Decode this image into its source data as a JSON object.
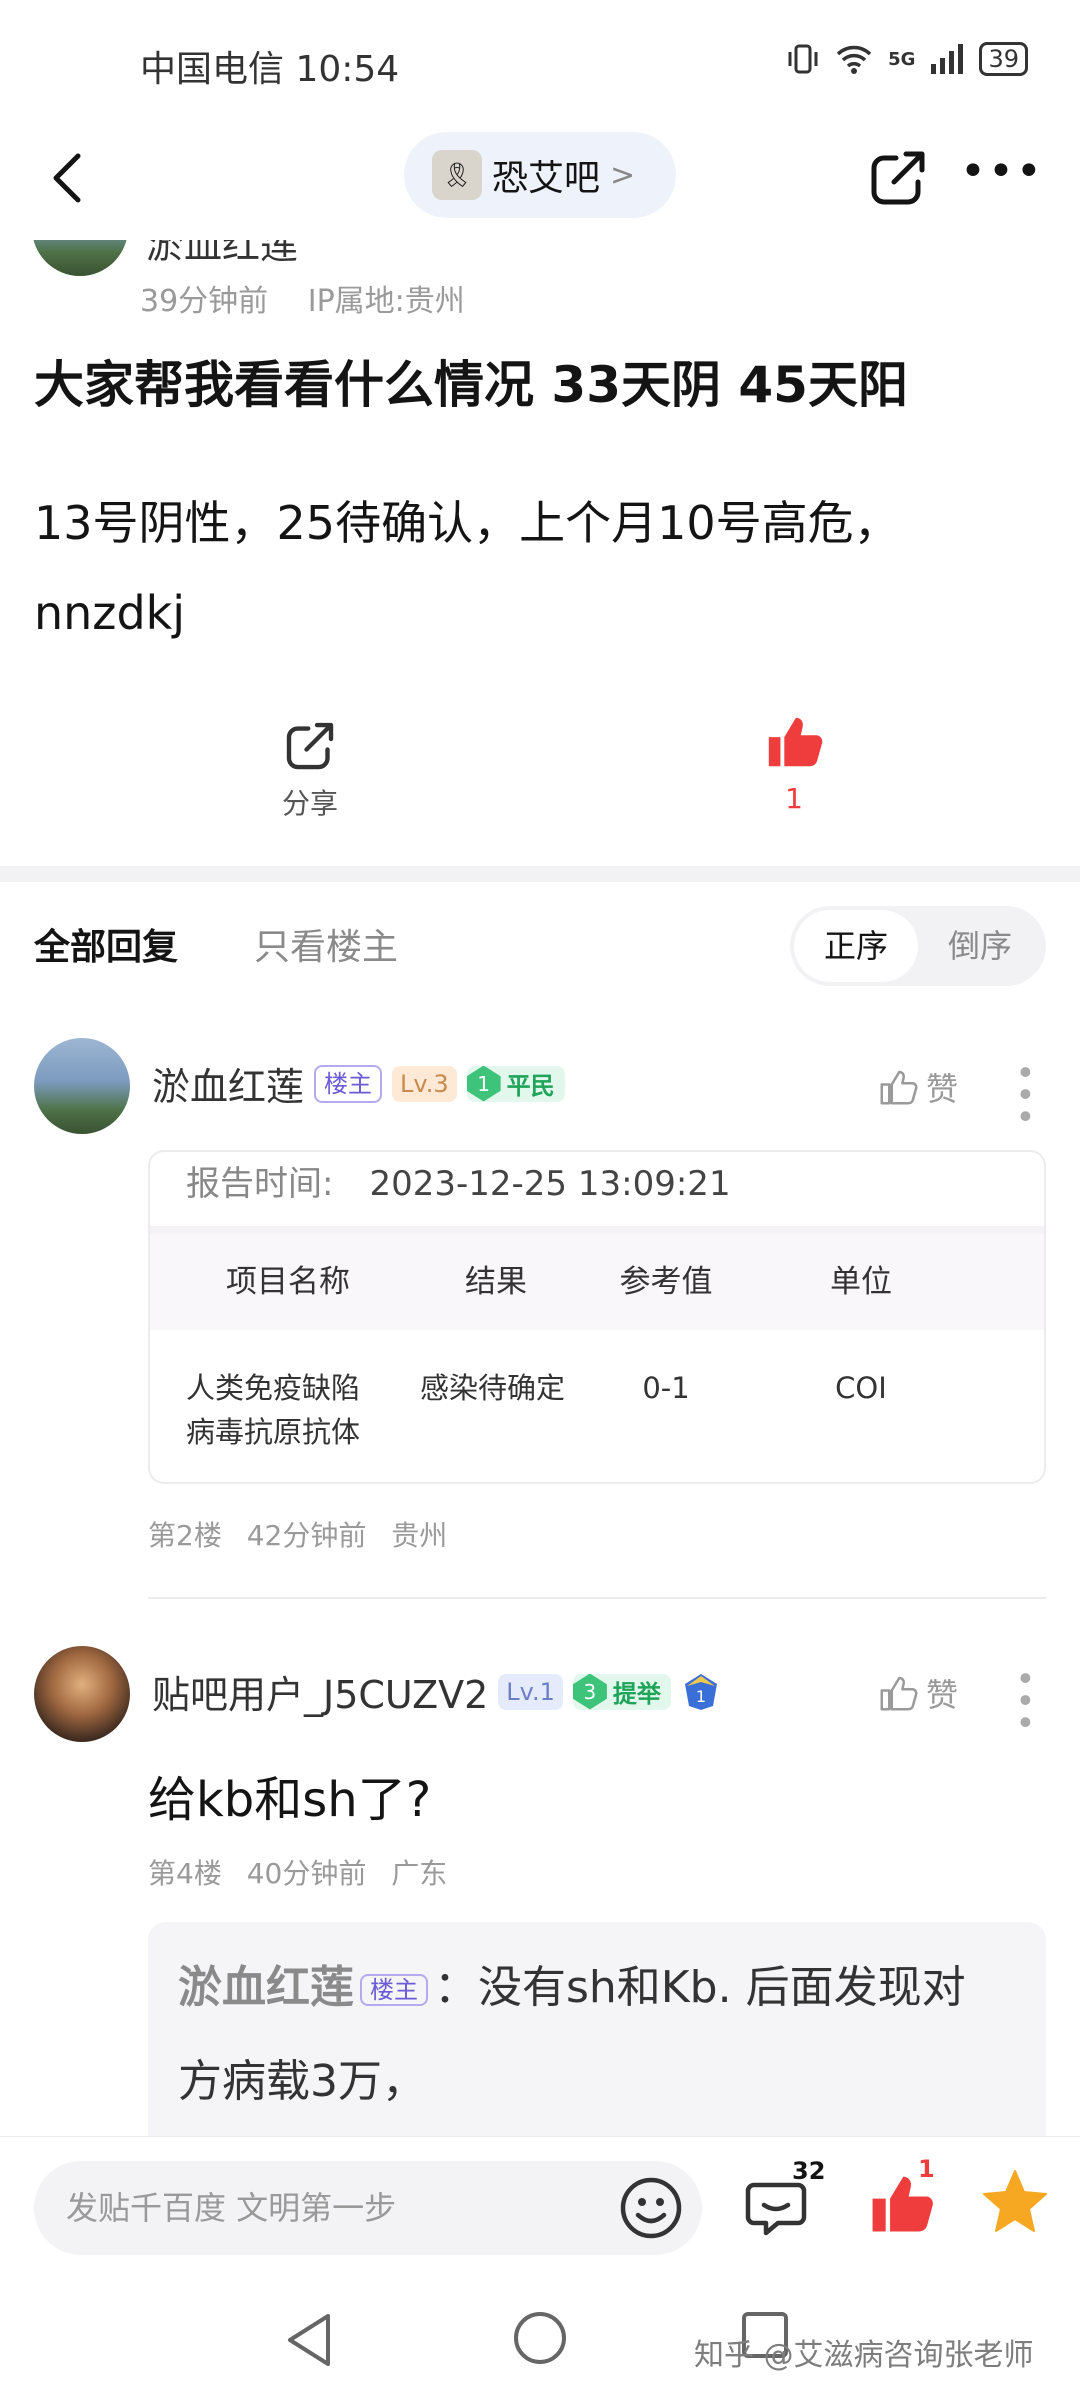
{
  "status_bar": {
    "carrier_time": "中国电信 10:54",
    "network": "5G",
    "battery": "39"
  },
  "nav": {
    "forum_name": "恐艾吧",
    "forum_chevron": ">"
  },
  "post": {
    "author_name_partial": "淤血红莲",
    "time": "39分钟前",
    "ip": "IP属地:贵州",
    "title": "大家帮我看看什么情况 33天阴 45天阳",
    "body_line1": "13号阴性，25待确认，上个月10号高危，",
    "body_line2": "nnzdkj",
    "share_label": "分享",
    "like_count": "1"
  },
  "tabs": {
    "all": "全部回复",
    "op_only": "只看楼主",
    "sort_asc": "正序",
    "sort_desc": "倒序"
  },
  "replies": [
    {
      "username": "淤血红莲",
      "op_tag": "楼主",
      "level": "Lv.3",
      "rank_num": "1",
      "rank_name": "平民",
      "like_label": "赞",
      "report": {
        "time_label": "报告时间:",
        "time_value": "2023-12-25 13:09:21",
        "headers": [
          "项目名称",
          "结果",
          "参考值",
          "单位"
        ],
        "row": {
          "item_line1": "人类免疫缺陷",
          "item_line2": "病毒抗原抗体",
          "result": "感染待确定",
          "reference": "0-1",
          "unit": "COI"
        }
      },
      "floor": "第2楼",
      "time": "42分钟前",
      "location": "贵州"
    },
    {
      "username": "贴吧用户_J5CUZV2",
      "level": "Lv.1",
      "rank_num": "3",
      "rank_name": "提举",
      "badge_num": "1",
      "like_label": "赞",
      "text": "给kb和sh了?",
      "floor": "第4楼",
      "time": "40分钟前",
      "location": "广东",
      "sub_reply": {
        "username": "淤血红莲",
        "op_tag": "楼主",
        "text_line1": "：没有sh和Kb. 后面发现对",
        "text_line2": "方病载3万，"
      }
    }
  ],
  "bottom_bar": {
    "input_placeholder": "发贴千百度 文明第一步",
    "comment_count": "32",
    "like_count": "1"
  },
  "watermark": "知乎 @艾滋病咨询张老师",
  "colors": {
    "like_red": "#ef3d3d",
    "rank_green": "#3dc47a",
    "star_orange": "#f7a823",
    "op_purple": "#6b5bd6"
  }
}
